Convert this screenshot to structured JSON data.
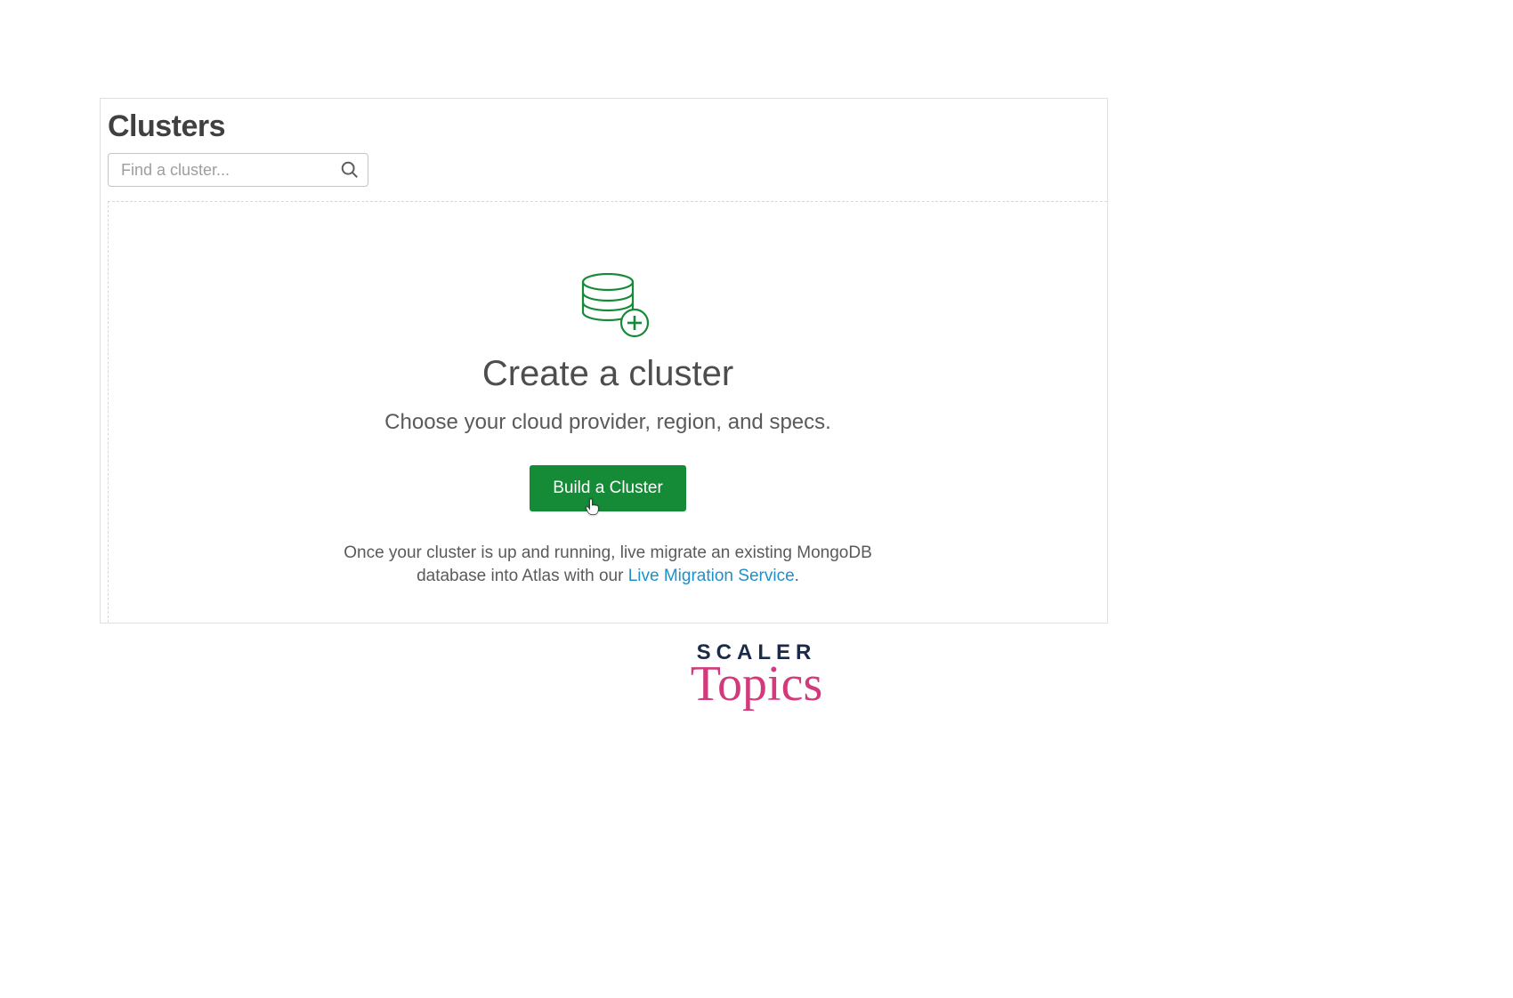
{
  "header": {
    "title": "Clusters",
    "search_placeholder": "Find a cluster..."
  },
  "empty_state": {
    "title": "Create a cluster",
    "subtitle": "Choose your cloud provider, region, and specs.",
    "button_label": "Build a Cluster",
    "footer_text_before": "Once your cluster is up and running, live migrate an existing MongoDB database into Atlas with our ",
    "footer_link": "Live Migration Service",
    "footer_text_after": "."
  },
  "brand": {
    "line1": "SCALER",
    "line2": "Topics"
  },
  "colors": {
    "accent_green": "#158a37",
    "link_blue": "#2090c6",
    "brand_navy": "#1c2a4a",
    "brand_pink": "#d13b7b"
  }
}
